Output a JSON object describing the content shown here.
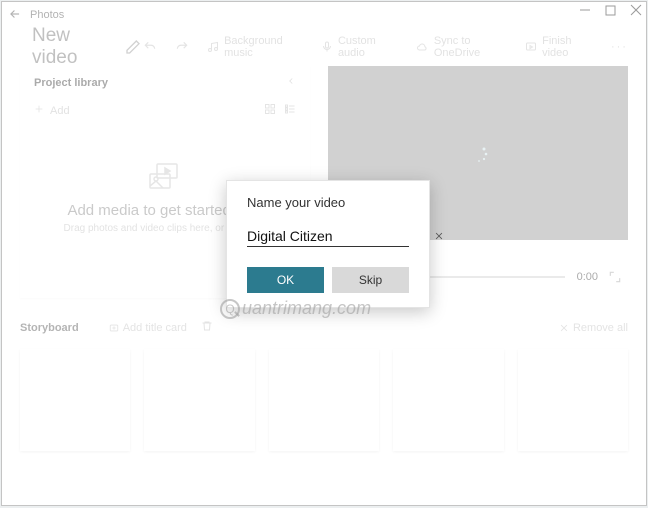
{
  "app": {
    "title": "Photos",
    "project_name": "New video"
  },
  "toolbar": {
    "undo": "",
    "redo": "",
    "bg_music": "Background music",
    "custom_audio": "Custom audio",
    "sync": "Sync to OneDrive",
    "finish": "Finish video"
  },
  "library": {
    "title": "Project library",
    "add": "Add",
    "empty_title": "Add media to get started now",
    "empty_sub": "Drag photos and video clips here, or click Add"
  },
  "preview": {
    "time": "0:00"
  },
  "storyboard": {
    "title": "Storyboard",
    "add_title_card": "Add title card",
    "remove_all": "Remove all"
  },
  "dialog": {
    "title": "Name your video",
    "value": "Digital Citizen",
    "ok": "OK",
    "skip": "Skip"
  },
  "watermark": "uantrimang.com"
}
